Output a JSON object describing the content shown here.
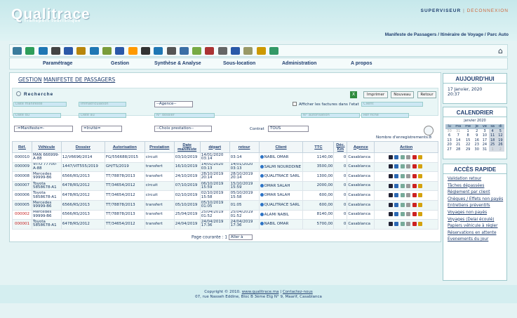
{
  "header": {
    "logo": "Qualitrace",
    "tagline": "Transport touristique",
    "user": "SUPERVISEUR",
    "user_sep": "|",
    "logout": "DECONNEXION",
    "crumb": "Manifeste de Passagers / Itinéraire de Voyage / Parc Auto"
  },
  "toolbar_icons": [
    "car-icon",
    "bus-icon",
    "person-icon",
    "car-icon",
    "car-icon",
    "bus-icon",
    "car-icon",
    "chart-icon",
    "car-icon",
    "bus-icon",
    "road-icon",
    "car-icon",
    "tools-icon",
    "gauge-icon",
    "clipboard-icon",
    "calendar-icon",
    "wrench-icon",
    "car-icon",
    "document-icon",
    "money-icon",
    "money-icon"
  ],
  "menu": [
    "Paramétrage",
    "Gestion",
    "Synthèse & Analyse",
    "Sous-location",
    "Administration",
    "A propos"
  ],
  "breadcrumb": {
    "a": "GESTION",
    "b": "MANIFESTE DE PASSAGERS"
  },
  "search": {
    "title": "Recherche",
    "print": "Imprimer",
    "new": "Nouveau",
    "back": "Retour",
    "ph_manifeste": "Date manifeste",
    "ph_immat": "immatriculation",
    "agence": "--Agence--",
    "checkbox_label": "Afficher les factures dans l'etat",
    "ph_client": "Client",
    "ph_date_du": "Date du",
    "ph_date_au": "Date au",
    "ph_dossier": "N° dossier",
    "ph_autorisation": "N° autorisation",
    "ph_fiche": "Ref fiche",
    "manifeste_sel": "-=Manifeste=-",
    "invite_sel": "=Invité=",
    "prestation_sel": "--Choix prestation--",
    "contrat_label": "Contrat",
    "contrat_sel": "TOUS",
    "count": "Nombre d'enregistrements:8"
  },
  "table": {
    "headers": [
      "Réf.",
      "Véhicule",
      "Dossier",
      "Autorisation",
      "Prestation",
      "Date manifeste",
      "départ",
      "retour",
      "Client",
      "TTC",
      "Déc. Km",
      "Agence",
      "Action"
    ],
    "rows": [
      [
        "000010",
        "MAN 666999-A-88",
        "12/V6696/2014",
        "FG/556688/2015",
        "circuit",
        "03/10/2019",
        "14/01/2020 03:14",
        "03:14",
        "NABIL OMAR",
        "1140,00",
        "0",
        "Casablanca"
      ],
      [
        "000009",
        "VITO 77700-A-88",
        "1447/VIT555/2019",
        "GH/TS/2019",
        "transfert",
        "16/10/2019",
        "14/01/2020 03:13",
        "14/01/2020 03:13",
        "SALMI NOURDDINE",
        "3500,00",
        "0",
        "Casablanca"
      ],
      [
        "000008",
        "Mercedes 99999-B6",
        "6566/RS/2013",
        "TT/78878/2013",
        "transfert",
        "24/10/2019",
        "28/10/2019 20:14",
        "28/10/2019 20:14",
        "QUALITRACE SARL",
        "1300,00",
        "0",
        "Casablanca"
      ],
      [
        "000007",
        "Toyota 5858678-A1",
        "6478/RS/2012",
        "TT/34654/2012",
        "circuit",
        "07/10/2019",
        "06/10/2019 15:59",
        "15/10/2019 15:59",
        "OMAR SALAH",
        "2000,00",
        "0",
        "Casablanca"
      ],
      [
        "000006",
        "Toyota 5858678-A1",
        "6478/RS/2012",
        "TT/34654/2012",
        "circuit",
        "02/10/2019",
        "02/10/2019 15:58",
        "05/10/2019 15:58",
        "OMAR SALAH",
        "600,00",
        "0",
        "Casablanca"
      ],
      [
        "000005",
        "Mercedes 99999-B6",
        "6566/RS/2013",
        "TT/78878/2013",
        "transfert",
        "05/10/2019",
        "05/10/2019 01:05",
        "01:05",
        "QUALITRACE SARL",
        "600,00",
        "0",
        "Casablanca"
      ],
      [
        "000002",
        "Mercedes 99999-B6",
        "6566/RS/2013",
        "TT/78878/2013",
        "transfert",
        "25/04/2019",
        "25/04/2019 01:52",
        "25/04/2019 01:52",
        "ALAMI NABIL",
        "8140,00",
        "0",
        "Casablanca"
      ],
      [
        "000001",
        "Toyota 5858678-A1",
        "6478/RS/2012",
        "TT/34654/2012",
        "transfert",
        "24/04/2019",
        "24/04/2019 17:36",
        "24/04/2019 17:36",
        "NABIL OMAR",
        "5700,00",
        "0",
        "Casablanca"
      ]
    ]
  },
  "pager": {
    "label": "Page courante : 1",
    "select": "Aller à"
  },
  "today": {
    "title": "AUJOURD'HUI",
    "date": "17 Janvier, 2020",
    "time": "20:37"
  },
  "calendar": {
    "title": "CALENDRIER",
    "month": "janvier 2020",
    "days": [
      "lu",
      "ma",
      "me",
      "je",
      "ve",
      "sa",
      "di"
    ],
    "weeks": [
      [
        "30",
        "31",
        "1",
        "2",
        "3",
        "4",
        "5"
      ],
      [
        "6",
        "7",
        "8",
        "9",
        "10",
        "11",
        "12"
      ],
      [
        "13",
        "14",
        "15",
        "16",
        "17",
        "18",
        "19"
      ],
      [
        "20",
        "21",
        "22",
        "23",
        "24",
        "25",
        "26"
      ],
      [
        "27",
        "28",
        "29",
        "30",
        "31",
        "1",
        "2"
      ]
    ]
  },
  "quick": {
    "title": "ACCÈS RAPIDE",
    "links": [
      "Validation retour",
      "Tâches dépassées",
      "Règlement par client",
      "Chèques / Effets non payés",
      "Entretiens préventifs",
      "Voyages non payés",
      "Voyages (Delai écoulé)",
      "Papiers véhicule à régler",
      "Réservations en attente",
      "Evenements du jour"
    ]
  },
  "footer": {
    "line1": "Copyright © 2010.",
    "site": "www.qualitrace.ma",
    "sep": " | ",
    "contact": "Contactez-nous",
    "line2": "07, rue Nasseh Eddine, Bloc B 3ème Etg N° 9, Maarif, Casablanca"
  }
}
